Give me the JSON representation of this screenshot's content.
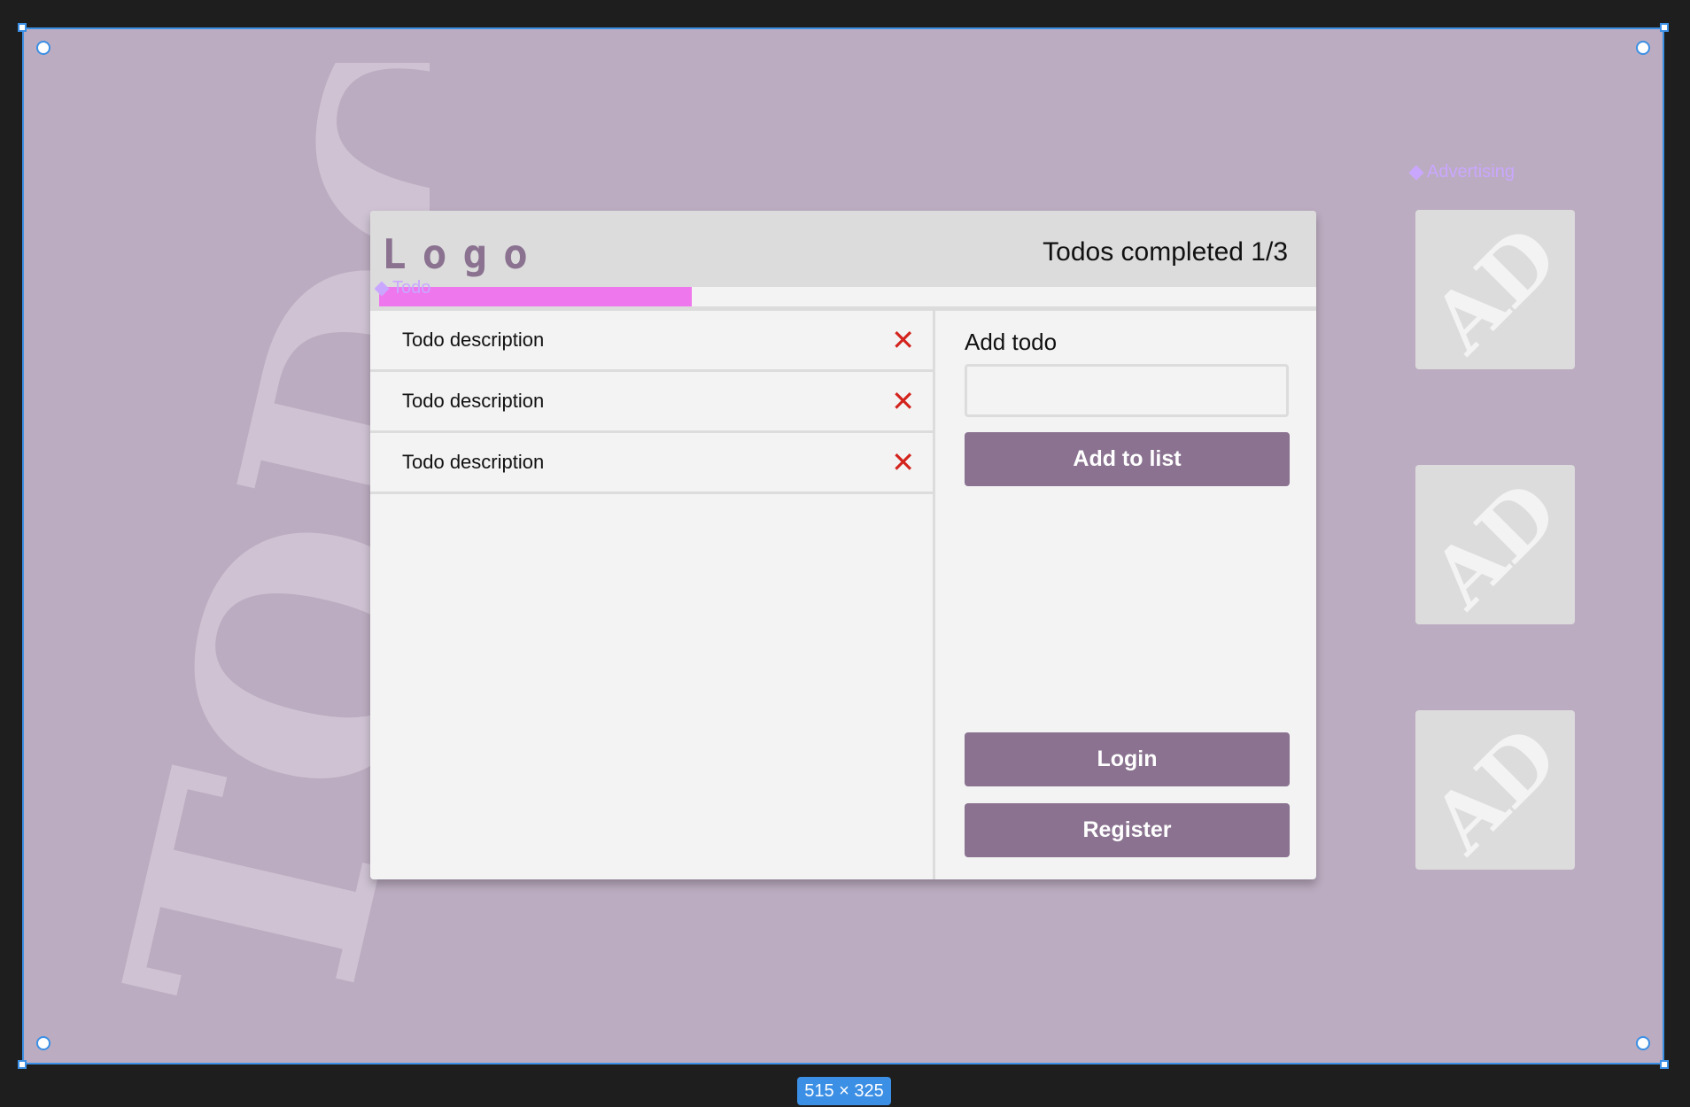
{
  "frame": {
    "size_label": "515 × 325",
    "background": "#bcacc1"
  },
  "watermark": {
    "text": "TODOS"
  },
  "component_labels": {
    "todo": "Todo",
    "advertising": "Advertising"
  },
  "ads": [
    {
      "text": "AD"
    },
    {
      "text": "AD"
    },
    {
      "text": "AD"
    }
  ],
  "header": {
    "logo": "Logo",
    "completed": "Todos completed 1/3",
    "progress": {
      "completed": 1,
      "total": 3,
      "fill_color": "#ee77ee"
    }
  },
  "todos": [
    {
      "text": "Todo description"
    },
    {
      "text": "Todo description"
    },
    {
      "text": "Todo description"
    }
  ],
  "add_panel": {
    "label": "Add todo",
    "input_value": "",
    "add_button": "Add to list",
    "login_button": "Login",
    "register_button": "Register"
  },
  "colors": {
    "accent": "#8a7290",
    "delete": "#d3231c",
    "selection": "#3b8fe4"
  }
}
